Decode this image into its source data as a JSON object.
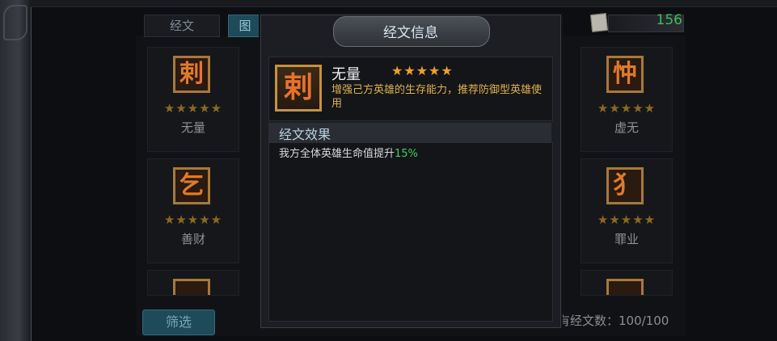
{
  "tabs": [
    {
      "label": "经文"
    },
    {
      "label": "图"
    }
  ],
  "currency": {
    "value": "156",
    "icon": "scroll-icon"
  },
  "cards_left": [
    {
      "name": "无量",
      "stars": "★★★★★",
      "glyph": "剌"
    },
    {
      "name": "善财",
      "stars": "★★★★★",
      "glyph": "乞"
    }
  ],
  "cards_right": [
    {
      "name": "虚无",
      "stars": "★★★★★",
      "glyph": "忡"
    },
    {
      "name": "罪业",
      "stars": "★★★★★",
      "glyph": "犭"
    }
  ],
  "filter_label": "筛选",
  "owned_count": "有经文数：100/100",
  "modal": {
    "title": "经文信息",
    "item": {
      "name": "无量",
      "stars": "★★★★★",
      "glyph": "剌",
      "description": "增强己方英雄的生存能力，推荐防御型英雄使用"
    },
    "effect_title": "经文效果",
    "effect_text": "我方全体英雄生命值提升",
    "effect_value": "15%"
  },
  "colors": {
    "star": "#f0a21c",
    "accent": "#3fcf5d",
    "desc": "#e0b24a"
  }
}
